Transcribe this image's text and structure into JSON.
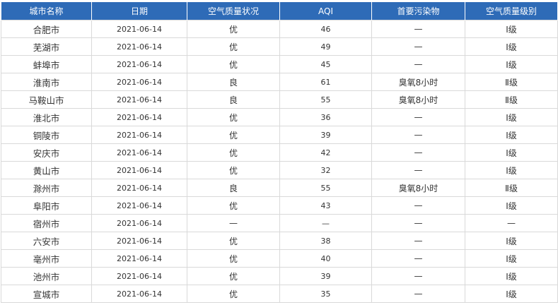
{
  "table": {
    "headers": [
      "城市名称",
      "日期",
      "空气质量状况",
      "AQI",
      "首要污染物",
      "空气质量级别"
    ],
    "rows": [
      [
        "合肥市",
        "2021-06-14",
        "优",
        "46",
        "—",
        "Ⅰ级"
      ],
      [
        "芜湖市",
        "2021-06-14",
        "优",
        "49",
        "—",
        "Ⅰ级"
      ],
      [
        "蚌埠市",
        "2021-06-14",
        "优",
        "45",
        "—",
        "Ⅰ级"
      ],
      [
        "淮南市",
        "2021-06-14",
        "良",
        "61",
        "臭氧8小时",
        "Ⅱ级"
      ],
      [
        "马鞍山市",
        "2021-06-14",
        "良",
        "55",
        "臭氧8小时",
        "Ⅱ级"
      ],
      [
        "淮北市",
        "2021-06-14",
        "优",
        "36",
        "—",
        "Ⅰ级"
      ],
      [
        "铜陵市",
        "2021-06-14",
        "优",
        "39",
        "—",
        "Ⅰ级"
      ],
      [
        "安庆市",
        "2021-06-14",
        "优",
        "42",
        "—",
        "Ⅰ级"
      ],
      [
        "黄山市",
        "2021-06-14",
        "优",
        "32",
        "—",
        "Ⅰ级"
      ],
      [
        "滁州市",
        "2021-06-14",
        "良",
        "55",
        "臭氧8小时",
        "Ⅱ级"
      ],
      [
        "阜阳市",
        "2021-06-14",
        "优",
        "43",
        "—",
        "Ⅰ级"
      ],
      [
        "宿州市",
        "2021-06-14",
        "—",
        "—",
        "—",
        "—"
      ],
      [
        "六安市",
        "2021-06-14",
        "优",
        "38",
        "—",
        "Ⅰ级"
      ],
      [
        "亳州市",
        "2021-06-14",
        "优",
        "40",
        "—",
        "Ⅰ级"
      ],
      [
        "池州市",
        "2021-06-14",
        "优",
        "39",
        "—",
        "Ⅰ级"
      ],
      [
        "宣城市",
        "2021-06-14",
        "优",
        "35",
        "—",
        "Ⅰ级"
      ]
    ]
  },
  "colors": {
    "header_bg": "#2e6bb7",
    "header_text": "#ffffff",
    "border": "#d9d9d9",
    "text": "#333333"
  }
}
